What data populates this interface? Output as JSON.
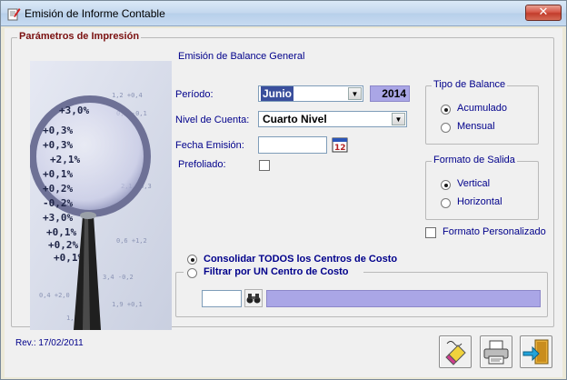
{
  "window": {
    "title": "Emisión de Informe Contable",
    "close_label": "✕"
  },
  "params": {
    "group_title": "Parámetros de Impresión",
    "subtitle": "Emisión de Balance General",
    "periodo": {
      "label": "Período:",
      "value": "Junio",
      "year": "2014"
    },
    "nivel": {
      "label": "Nivel de Cuenta:",
      "value": "Cuarto Nivel"
    },
    "fecha": {
      "label": "Fecha Emisión:",
      "value": ""
    },
    "prefoliado": {
      "label": "Prefoliado:",
      "checked": false
    },
    "photo_numbers": [
      "+3,0%",
      "+0,3%",
      "+0,3%",
      "+2,1%",
      "+0,1%",
      "+0,2%",
      "-0,2%",
      "+3,0%",
      "+0,1%",
      "+0,2%",
      "+0,1%"
    ]
  },
  "tipo_balance": {
    "title": "Tipo de Balance",
    "options": [
      "Acumulado",
      "Mensual"
    ],
    "selected": "Acumulado"
  },
  "formato_salida": {
    "title": "Formato de Salida",
    "options": [
      "Vertical",
      "Horizontal"
    ],
    "selected": "Vertical"
  },
  "formato_personalizado": {
    "label": "Formato Personalizado",
    "checked": false
  },
  "centros": {
    "consolidar_label": "Consolidar TODOS los Centros de Costo",
    "filtrar_label": "Filtrar por UN Centro de Costo",
    "selected": "consolidar",
    "code": "",
    "name": ""
  },
  "footer": {
    "revision": "Rev.: 17/02/2011"
  },
  "icons": {
    "title": "document-edit-icon",
    "calendar": "calendar-icon",
    "binoculars": "binoculars-icon",
    "clear": "eraser-icon",
    "print": "printer-icon",
    "exit": "exit-door-icon"
  }
}
